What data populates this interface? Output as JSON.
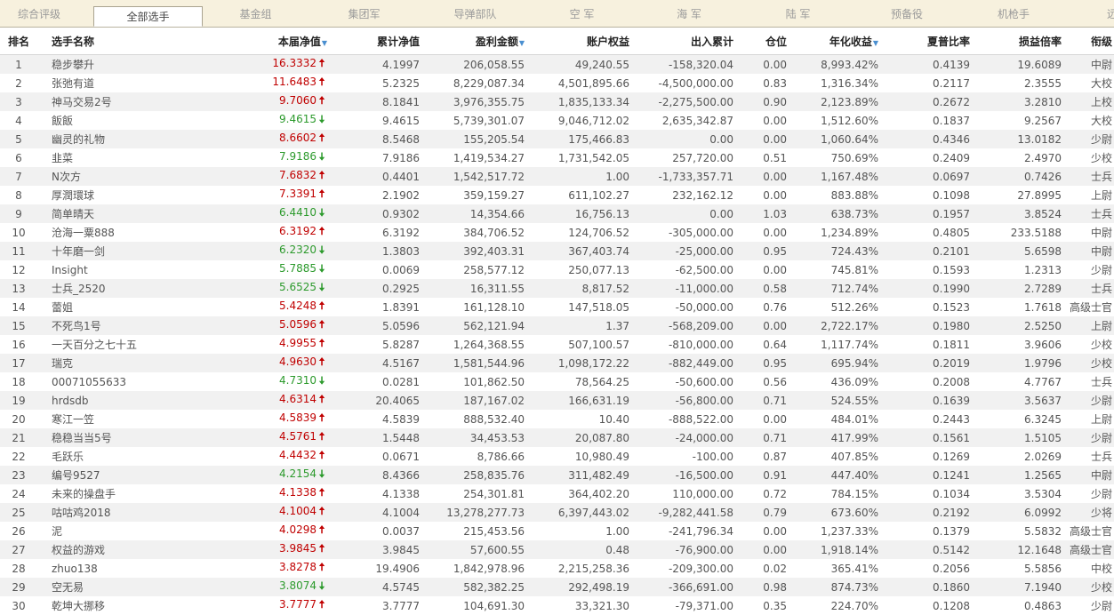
{
  "tabs": [
    "综合评级",
    "全部选手",
    "基金组",
    "集团军",
    "导弹部队",
    "空 军",
    "海 军",
    "陆 军",
    "预备役",
    "机枪手",
    "远"
  ],
  "active_tab": 1,
  "columns": {
    "rank": "排名",
    "name": "选手名称",
    "current_nav": "本届净值",
    "cum_nav": "累计净值",
    "profit": "盈利金额",
    "equity": "账户权益",
    "flow": "出入累计",
    "position": "仓位",
    "annual": "年化收益",
    "sharpe": "夏普比率",
    "pl_ratio": "损益倍率",
    "title": "衔级"
  },
  "sort_marker": "▼",
  "trend_symbols": {
    "up": "🠅",
    "down": "🠇"
  },
  "colors": {
    "up": "#c00000",
    "down": "#2c9a2c",
    "sort_arrow": "#4a8fd0",
    "tab_bar": "#f7f1de",
    "row_stripe": "#f1f1f1"
  },
  "rows": [
    {
      "rank": "1",
      "name": "稳步攀升",
      "nav": "16.3332",
      "trend": "up",
      "cum": "4.1997",
      "profit": "206,058.55",
      "equity": "49,240.55",
      "flow": "-158,320.04",
      "pos": "0.00",
      "annual": "8,993.42%",
      "sharpe": "0.4139",
      "pl": "19.6089",
      "title": "中尉"
    },
    {
      "rank": "2",
      "name": "张弛有道",
      "nav": "11.6483",
      "trend": "up",
      "cum": "5.2325",
      "profit": "8,229,087.34",
      "equity": "4,501,895.66",
      "flow": "-4,500,000.00",
      "pos": "0.83",
      "annual": "1,316.34%",
      "sharpe": "0.2117",
      "pl": "2.3555",
      "title": "大校"
    },
    {
      "rank": "3",
      "name": "神马交易2号",
      "nav": "9.7060",
      "trend": "up",
      "cum": "8.1841",
      "profit": "3,976,355.75",
      "equity": "1,835,133.34",
      "flow": "-2,275,500.00",
      "pos": "0.90",
      "annual": "2,123.89%",
      "sharpe": "0.2672",
      "pl": "3.2810",
      "title": "上校"
    },
    {
      "rank": "4",
      "name": "飯飯",
      "nav": "9.4615",
      "trend": "down",
      "cum": "9.4615",
      "profit": "5,739,301.07",
      "equity": "9,046,712.02",
      "flow": "2,635,342.87",
      "pos": "0.00",
      "annual": "1,512.60%",
      "sharpe": "0.1837",
      "pl": "9.2567",
      "title": "大校"
    },
    {
      "rank": "5",
      "name": "幽灵的礼物",
      "nav": "8.6602",
      "trend": "up",
      "cum": "8.5468",
      "profit": "155,205.54",
      "equity": "175,466.83",
      "flow": "0.00",
      "pos": "0.00",
      "annual": "1,060.64%",
      "sharpe": "0.4346",
      "pl": "13.0182",
      "title": "少尉"
    },
    {
      "rank": "6",
      "name": "韭菜",
      "nav": "7.9186",
      "trend": "down",
      "cum": "7.9186",
      "profit": "1,419,534.27",
      "equity": "1,731,542.05",
      "flow": "257,720.00",
      "pos": "0.51",
      "annual": "750.69%",
      "sharpe": "0.2409",
      "pl": "2.4970",
      "title": "少校"
    },
    {
      "rank": "7",
      "name": "N次方",
      "nav": "7.6832",
      "trend": "up",
      "cum": "0.4401",
      "profit": "1,542,517.72",
      "equity": "1.00",
      "flow": "-1,733,357.71",
      "pos": "0.00",
      "annual": "1,167.48%",
      "sharpe": "0.0697",
      "pl": "0.7426",
      "title": "士兵"
    },
    {
      "rank": "8",
      "name": "厚潤環球",
      "nav": "7.3391",
      "trend": "up",
      "cum": "2.1902",
      "profit": "359,159.27",
      "equity": "611,102.27",
      "flow": "232,162.12",
      "pos": "0.00",
      "annual": "883.88%",
      "sharpe": "0.1098",
      "pl": "27.8995",
      "title": "上尉"
    },
    {
      "rank": "9",
      "name": "简单晴天",
      "nav": "6.4410",
      "trend": "down",
      "cum": "0.9302",
      "profit": "14,354.66",
      "equity": "16,756.13",
      "flow": "0.00",
      "pos": "1.03",
      "annual": "638.73%",
      "sharpe": "0.1957",
      "pl": "3.8524",
      "title": "士兵"
    },
    {
      "rank": "10",
      "name": "沧海一粟888",
      "nav": "6.3192",
      "trend": "up",
      "cum": "6.3192",
      "profit": "384,706.52",
      "equity": "124,706.52",
      "flow": "-305,000.00",
      "pos": "0.00",
      "annual": "1,234.89%",
      "sharpe": "0.4805",
      "pl": "233.5188",
      "title": "中尉"
    },
    {
      "rank": "11",
      "name": "十年磨一剑",
      "nav": "6.2320",
      "trend": "down",
      "cum": "1.3803",
      "profit": "392,403.31",
      "equity": "367,403.74",
      "flow": "-25,000.00",
      "pos": "0.95",
      "annual": "724.43%",
      "sharpe": "0.2101",
      "pl": "5.6598",
      "title": "中尉"
    },
    {
      "rank": "12",
      "name": "Insight",
      "nav": "5.7885",
      "trend": "down",
      "cum": "0.0069",
      "profit": "258,577.12",
      "equity": "250,077.13",
      "flow": "-62,500.00",
      "pos": "0.00",
      "annual": "745.81%",
      "sharpe": "0.1593",
      "pl": "1.2313",
      "title": "少尉"
    },
    {
      "rank": "13",
      "name": "士兵_2520",
      "nav": "5.6525",
      "trend": "down",
      "cum": "0.2925",
      "profit": "16,311.55",
      "equity": "8,817.52",
      "flow": "-11,000.00",
      "pos": "0.58",
      "annual": "712.74%",
      "sharpe": "0.1990",
      "pl": "2.7289",
      "title": "士兵"
    },
    {
      "rank": "14",
      "name": "蕾姐",
      "nav": "5.4248",
      "trend": "up",
      "cum": "1.8391",
      "profit": "161,128.10",
      "equity": "147,518.05",
      "flow": "-50,000.00",
      "pos": "0.76",
      "annual": "512.26%",
      "sharpe": "0.1523",
      "pl": "1.7618",
      "title": "高级士官"
    },
    {
      "rank": "15",
      "name": "不死鸟1号",
      "nav": "5.0596",
      "trend": "up",
      "cum": "5.0596",
      "profit": "562,121.94",
      "equity": "1.37",
      "flow": "-568,209.00",
      "pos": "0.00",
      "annual": "2,722.17%",
      "sharpe": "0.1980",
      "pl": "2.5250",
      "title": "上尉"
    },
    {
      "rank": "16",
      "name": "一天百分之七十五",
      "nav": "4.9955",
      "trend": "up",
      "cum": "5.8287",
      "profit": "1,264,368.55",
      "equity": "507,100.57",
      "flow": "-810,000.00",
      "pos": "0.64",
      "annual": "1,117.74%",
      "sharpe": "0.1811",
      "pl": "3.9606",
      "title": "少校"
    },
    {
      "rank": "17",
      "name": "瑞克",
      "nav": "4.9630",
      "trend": "up",
      "cum": "4.5167",
      "profit": "1,581,544.96",
      "equity": "1,098,172.22",
      "flow": "-882,449.00",
      "pos": "0.95",
      "annual": "695.94%",
      "sharpe": "0.2019",
      "pl": "1.9796",
      "title": "少校"
    },
    {
      "rank": "18",
      "name": "00071055633",
      "nav": "4.7310",
      "trend": "down",
      "cum": "0.0281",
      "profit": "101,862.50",
      "equity": "78,564.25",
      "flow": "-50,600.00",
      "pos": "0.56",
      "annual": "436.09%",
      "sharpe": "0.2008",
      "pl": "4.7767",
      "title": "士兵"
    },
    {
      "rank": "19",
      "name": "hrdsdb",
      "nav": "4.6314",
      "trend": "up",
      "cum": "20.4065",
      "profit": "187,167.02",
      "equity": "166,631.19",
      "flow": "-56,800.00",
      "pos": "0.71",
      "annual": "524.55%",
      "sharpe": "0.1639",
      "pl": "3.5637",
      "title": "少尉"
    },
    {
      "rank": "20",
      "name": "寒江一笠",
      "nav": "4.5839",
      "trend": "up",
      "cum": "4.5839",
      "profit": "888,532.40",
      "equity": "10.40",
      "flow": "-888,522.00",
      "pos": "0.00",
      "annual": "484.01%",
      "sharpe": "0.2443",
      "pl": "6.3245",
      "title": "上尉"
    },
    {
      "rank": "21",
      "name": "稳稳当当5号",
      "nav": "4.5761",
      "trend": "up",
      "cum": "1.5448",
      "profit": "34,453.53",
      "equity": "20,087.80",
      "flow": "-24,000.00",
      "pos": "0.71",
      "annual": "417.99%",
      "sharpe": "0.1561",
      "pl": "1.5105",
      "title": "少尉"
    },
    {
      "rank": "22",
      "name": "毛跃乐",
      "nav": "4.4432",
      "trend": "up",
      "cum": "0.0671",
      "profit": "8,786.66",
      "equity": "10,980.49",
      "flow": "-100.00",
      "pos": "0.87",
      "annual": "407.85%",
      "sharpe": "0.1269",
      "pl": "2.0269",
      "title": "士兵"
    },
    {
      "rank": "23",
      "name": "编号9527",
      "nav": "4.2154",
      "trend": "down",
      "cum": "8.4366",
      "profit": "258,835.76",
      "equity": "311,482.49",
      "flow": "-16,500.00",
      "pos": "0.91",
      "annual": "447.40%",
      "sharpe": "0.1241",
      "pl": "1.2565",
      "title": "中尉"
    },
    {
      "rank": "24",
      "name": "未来的操盘手",
      "nav": "4.1338",
      "trend": "up",
      "cum": "4.1338",
      "profit": "254,301.81",
      "equity": "364,402.20",
      "flow": "110,000.00",
      "pos": "0.72",
      "annual": "784.15%",
      "sharpe": "0.1034",
      "pl": "3.5304",
      "title": "少尉"
    },
    {
      "rank": "25",
      "name": "咕咕鸡2018",
      "nav": "4.1004",
      "trend": "up",
      "cum": "4.1004",
      "profit": "13,278,277.73",
      "equity": "6,397,443.02",
      "flow": "-9,282,441.58",
      "pos": "0.79",
      "annual": "673.60%",
      "sharpe": "0.2192",
      "pl": "6.0992",
      "title": "少将"
    },
    {
      "rank": "26",
      "name": "泥",
      "nav": "4.0298",
      "trend": "up",
      "cum": "0.0037",
      "profit": "215,453.56",
      "equity": "1.00",
      "flow": "-241,796.34",
      "pos": "0.00",
      "annual": "1,237.33%",
      "sharpe": "0.1379",
      "pl": "5.5832",
      "title": "高级士官"
    },
    {
      "rank": "27",
      "name": "权益的游戏",
      "nav": "3.9845",
      "trend": "up",
      "cum": "3.9845",
      "profit": "57,600.55",
      "equity": "0.48",
      "flow": "-76,900.00",
      "pos": "0.00",
      "annual": "1,918.14%",
      "sharpe": "0.5142",
      "pl": "12.1648",
      "title": "高级士官"
    },
    {
      "rank": "28",
      "name": "zhuo138",
      "nav": "3.8278",
      "trend": "up",
      "cum": "19.4906",
      "profit": "1,842,978.96",
      "equity": "2,215,258.36",
      "flow": "-209,300.00",
      "pos": "0.02",
      "annual": "365.41%",
      "sharpe": "0.2056",
      "pl": "5.5856",
      "title": "中校"
    },
    {
      "rank": "29",
      "name": "空无易",
      "nav": "3.8074",
      "trend": "down",
      "cum": "4.5745",
      "profit": "582,382.25",
      "equity": "292,498.19",
      "flow": "-366,691.00",
      "pos": "0.98",
      "annual": "874.73%",
      "sharpe": "0.1860",
      "pl": "7.1940",
      "title": "少校"
    },
    {
      "rank": "30",
      "name": "乾坤大挪移",
      "nav": "3.7777",
      "trend": "up",
      "cum": "3.7777",
      "profit": "104,691.30",
      "equity": "33,321.30",
      "flow": "-79,371.00",
      "pos": "0.35",
      "annual": "224.70%",
      "sharpe": "0.1208",
      "pl": "0.4863",
      "title": "少尉"
    }
  ]
}
